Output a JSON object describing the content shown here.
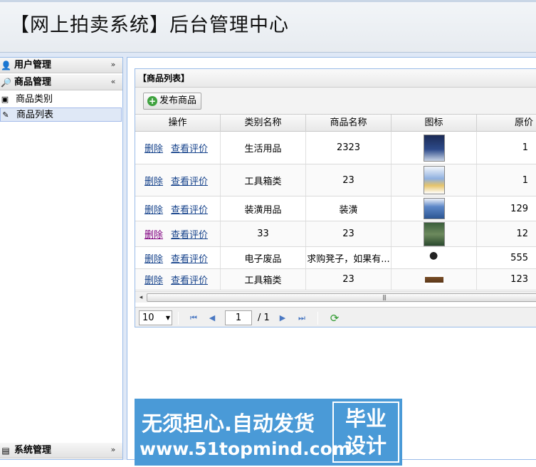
{
  "header": {
    "title": "【网上拍卖系统】后台管理中心"
  },
  "sidebar": {
    "sections": [
      {
        "label": "用户管理",
        "icon": "user-icon",
        "state": "collapsed"
      },
      {
        "label": "商品管理",
        "icon": "search-icon",
        "state": "expanded"
      },
      {
        "label": "系统管理",
        "icon": "list-icon",
        "state": "collapsed"
      }
    ],
    "items": [
      {
        "label": "商品类别",
        "icon": "category-icon",
        "selected": false
      },
      {
        "label": "商品列表",
        "icon": "edit-list-icon",
        "selected": true
      }
    ]
  },
  "grid": {
    "title": "【商品列表】",
    "add_button": "发布商品",
    "columns": [
      "操作",
      "类别名称",
      "商品名称",
      "图标",
      "原价"
    ],
    "delete_label": "删除",
    "review_label": "查看评价",
    "rows": [
      {
        "category": "生活用品",
        "name": "2323",
        "image": "book-cover",
        "price": "1"
      },
      {
        "category": "工具箱类",
        "name": "23",
        "image": "book-cover",
        "price": "1"
      },
      {
        "category": "装潢用品",
        "name": "装潢",
        "image": "book-cover",
        "price": "129"
      },
      {
        "category": "33",
        "name": "23",
        "image": "book-cover",
        "price": "12"
      },
      {
        "category": "电子废品",
        "name": "求购凳子，如果有...",
        "image": "chair-photo",
        "price": "555"
      },
      {
        "category": "工具箱类",
        "name": "23",
        "image": "box-photo",
        "price": "123"
      }
    ]
  },
  "pager": {
    "page_size": "10",
    "current_page": "1",
    "total": "/ 1"
  },
  "watermark": {
    "line1": "无须担心.自动发货",
    "line2": "www.51topmind.com",
    "box_line1": "毕业",
    "box_line2": "设计"
  },
  "colors": {
    "border": "#99bbe8",
    "selection": "#dfe8f6",
    "link": "#15428b",
    "watermark_bg": "#4a9ad7"
  }
}
